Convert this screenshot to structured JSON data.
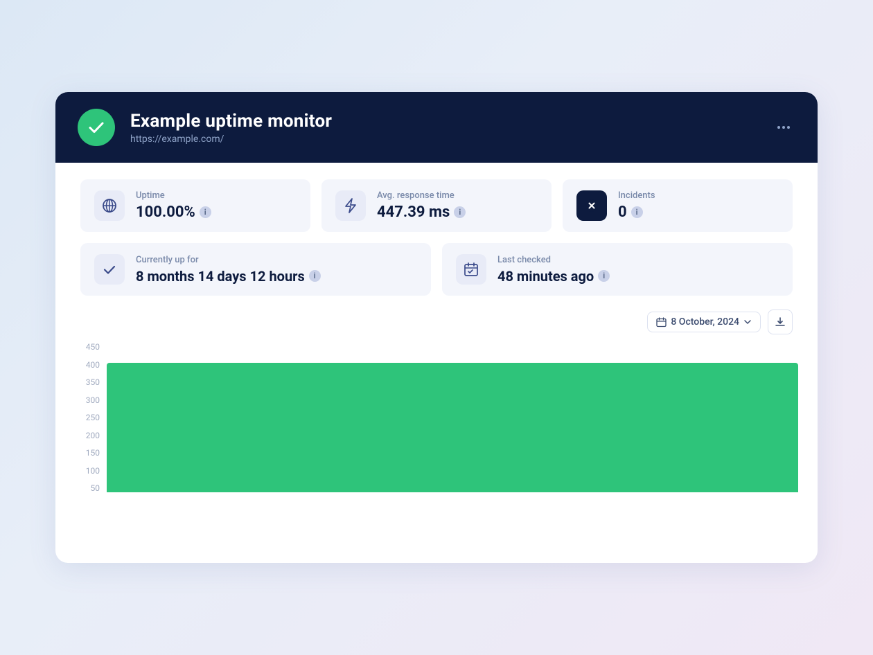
{
  "header": {
    "title": "Example uptime monitor",
    "url": "https://example.com/",
    "icon_alt": "check-icon"
  },
  "stats": [
    {
      "label": "Uptime",
      "value": "100.00%",
      "icon": "globe-icon"
    },
    {
      "label": "Avg. response time",
      "value": "447.39 ms",
      "icon": "bolt-icon"
    },
    {
      "label": "Incidents",
      "value": "0",
      "icon": "x-circle-icon"
    }
  ],
  "status": [
    {
      "label": "Currently up for",
      "value": "8 months 14 days 12 hours",
      "icon": "checkmark-icon"
    },
    {
      "label": "Last checked",
      "value": "48 minutes ago",
      "icon": "calendar-icon"
    }
  ],
  "chart": {
    "date": "8 October, 2024",
    "y_labels": [
      "450",
      "400",
      "350",
      "300",
      "250",
      "200",
      "150",
      "100",
      "50"
    ],
    "bar_height_pct": 85
  }
}
